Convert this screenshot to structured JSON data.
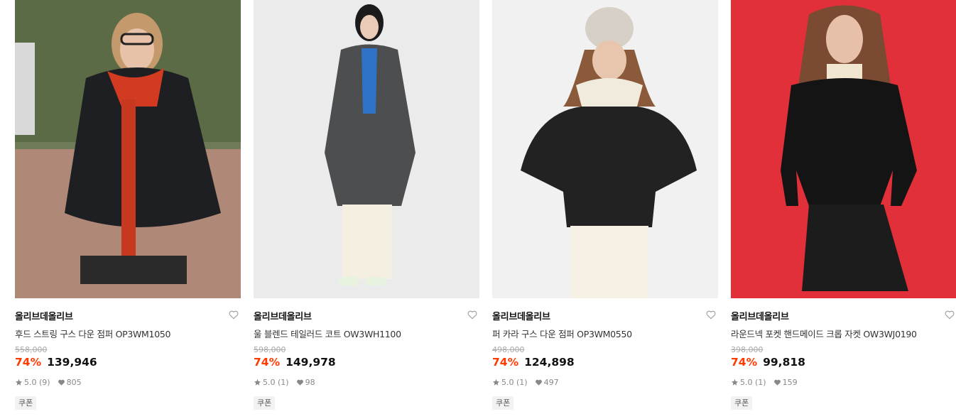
{
  "products": [
    {
      "brand": "올리브데올리브",
      "name": "후드 스트링 구스 다운 점퍼 OP3WM1050",
      "original_price": "558,000",
      "discount": "74%",
      "price": "139,946",
      "rating": "5.0 (9)",
      "likes": "805",
      "coupon_label": "쿠폰",
      "image_bg": "#9a8f82"
    },
    {
      "brand": "올리브데올리브",
      "name": "울 블렌드 테일러드 코트 OW3WH1100",
      "original_price": "598,000",
      "discount": "74%",
      "price": "149,978",
      "rating": "5.0 (1)",
      "likes": "98",
      "coupon_label": "쿠폰",
      "image_bg": "#ebebeb"
    },
    {
      "brand": "올리브데올리브",
      "name": "퍼 카라 구스 다운 점퍼 OP3WM0550",
      "original_price": "498,000",
      "discount": "74%",
      "price": "124,898",
      "rating": "5.0 (1)",
      "likes": "497",
      "coupon_label": "쿠폰",
      "image_bg": "#f2f2f2"
    },
    {
      "brand": "올리브데올리브",
      "name": "라운드넥 포켓 핸드메이드 크롭 자켓 OW3WJ0190",
      "original_price": "398,000",
      "discount": "74%",
      "price": "99,818",
      "rating": "5.0 (1)",
      "likes": "159",
      "coupon_label": "쿠폰",
      "image_bg": "#e2303a"
    }
  ],
  "icons": {
    "wishlist": "heart-outline-icon",
    "rating": "star-icon",
    "likes": "heart-filled-icon"
  },
  "colors": {
    "discount": "#ff3b00",
    "price": "#111111",
    "original_price": "#aaaaaa"
  }
}
